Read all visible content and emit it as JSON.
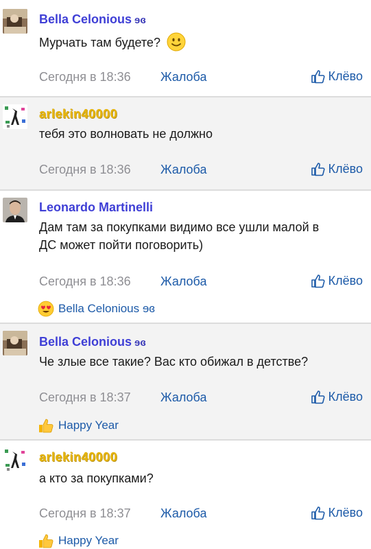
{
  "posts": [
    {
      "author": "Bella Celonious",
      "author_mark": "ɘɞ",
      "message": "Мурчать там будете?",
      "time": "Сегодня в 18:36",
      "report": "Жалоба",
      "like": "Клёво"
    },
    {
      "author": "arlekin40000",
      "message": "тебя это волновать не должно",
      "time": "Сегодня в 18:36",
      "report": "Жалоба",
      "like": "Клёво"
    },
    {
      "author": "Leonardo Martinelli",
      "message_line1": "Дам там за покупками видимо все ушли малой в",
      "message_line2": "ДС может пойти поговорить)",
      "time": "Сегодня в 18:36",
      "report": "Жалоба",
      "like": "Клёво",
      "reaction": "Bella Celonious ɘɞ"
    },
    {
      "author": "Bella Celonious",
      "author_mark": "ɘɞ",
      "message": "Че злые все такие? Вас кто обижал в детстве?",
      "time": "Сегодня в 18:37",
      "report": "Жалоба",
      "like": "Клёво",
      "reaction": "Happy Year"
    },
    {
      "author": "arlekin40000",
      "message": "а кто за покупками?",
      "time": "Сегодня в 18:37",
      "report": "Жалоба",
      "like": "Клёво",
      "reaction": "Happy Year"
    }
  ],
  "colors": {
    "link": "#1c5aa8",
    "author_blue": "#3f3fd6",
    "author_gold": "#e8b400",
    "timestamp": "#8e8e93",
    "shaded_bg": "#f3f3f3"
  },
  "icons": [
    "avatar",
    "smile-emoji",
    "thumbs-up-icon",
    "heart-eyes-emoji",
    "thumbs-up-emoji"
  ]
}
